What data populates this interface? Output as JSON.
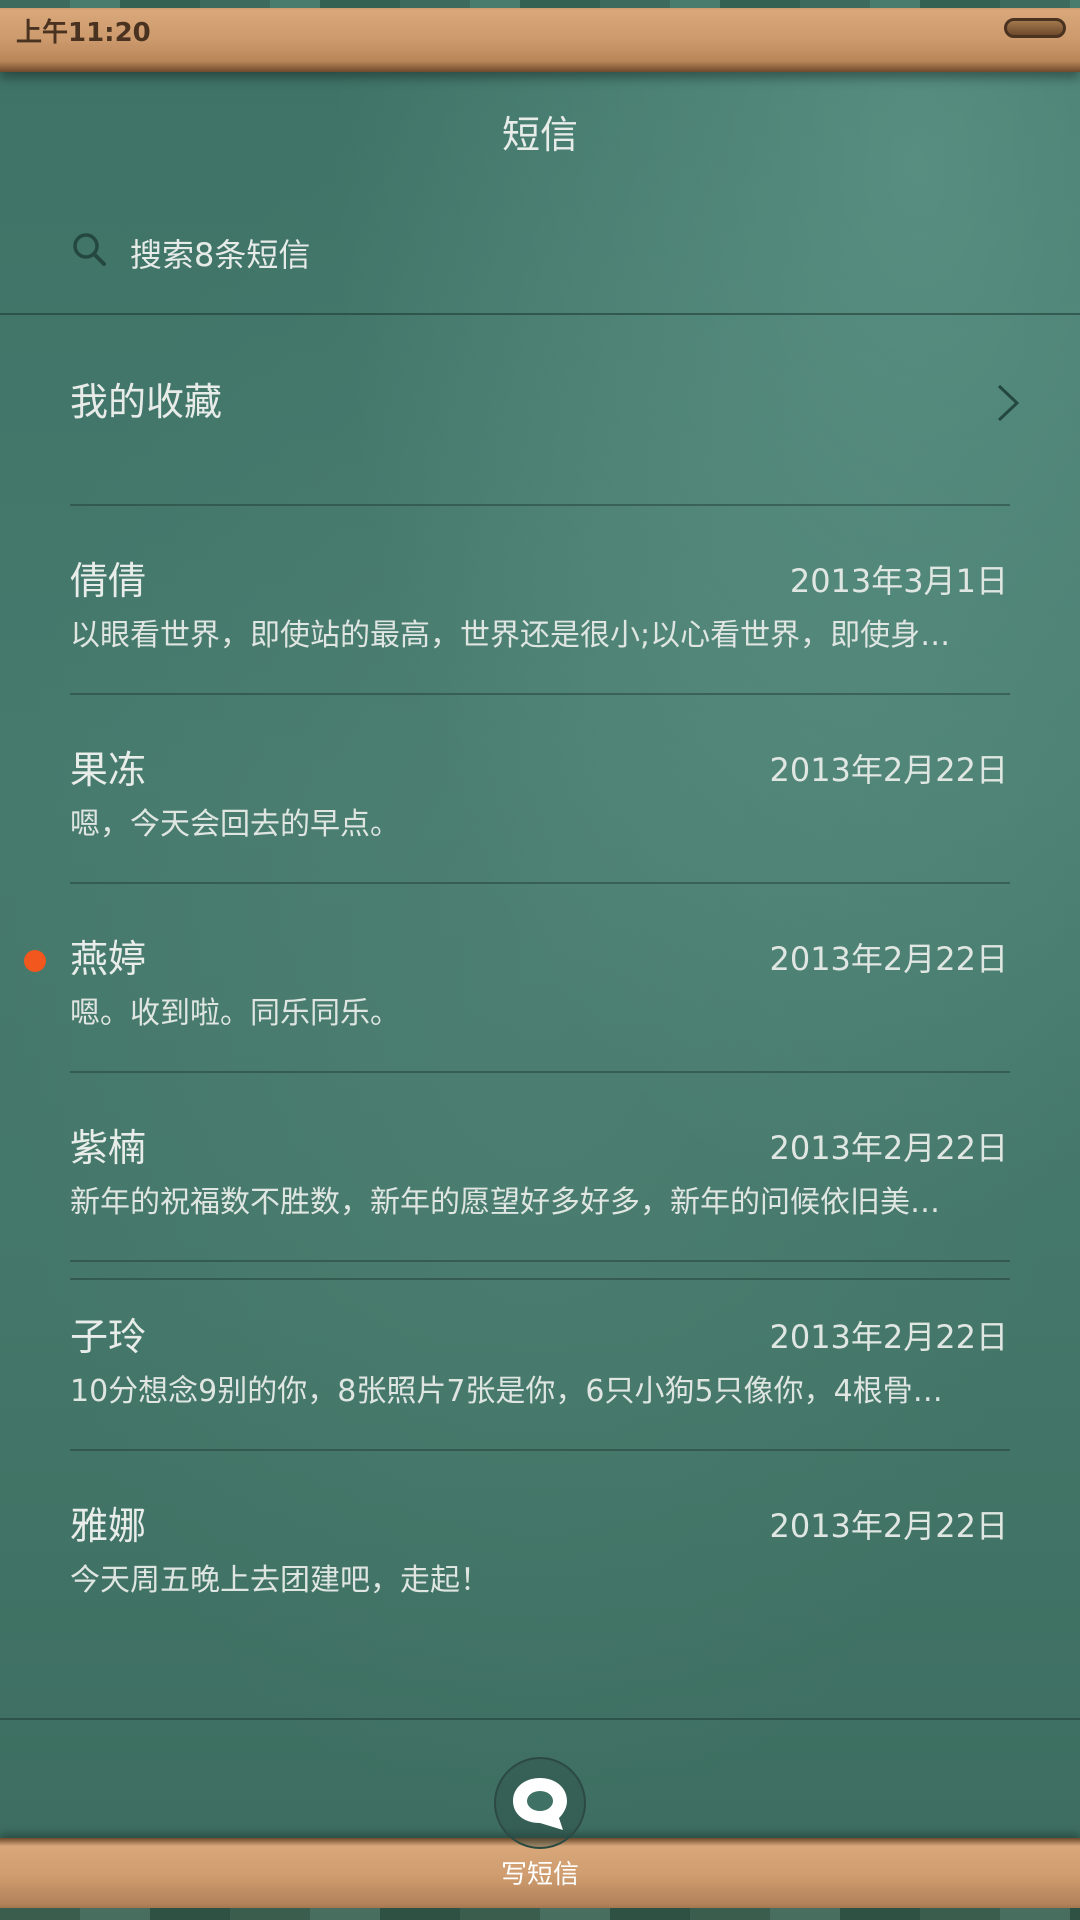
{
  "status_bar": {
    "time": "上午11:20"
  },
  "header": {
    "title": "短信"
  },
  "search": {
    "placeholder": "搜索8条短信"
  },
  "favorites": {
    "label": "我的收藏"
  },
  "conversations": [
    {
      "name": "倩倩",
      "date": "2013年3月1日",
      "preview": "以眼看世界，即使站的最高，世界还是很小;以心看世界，即使身…",
      "unread": false
    },
    {
      "name": "果冻",
      "date": "2013年2月22日",
      "preview": "嗯，今天会回去的早点。",
      "unread": false
    },
    {
      "name": "燕婷",
      "date": "2013年2月22日",
      "preview": "嗯。收到啦。同乐同乐。",
      "unread": true
    },
    {
      "name": "紫楠",
      "date": "2013年2月22日",
      "preview": "新年的祝福数不胜数，新年的愿望好多好多，新年的问候依旧美…",
      "unread": false
    },
    {
      "name": "子玲",
      "date": "2013年2月22日",
      "preview": "10分想念9别的你，8张照片7张是你，6只小狗5只像你，4根骨…",
      "unread": false
    },
    {
      "name": "雅娜",
      "date": "2013年2月22日",
      "preview": "今天周五晚上去团建吧，走起！",
      "unread": false
    }
  ],
  "bottom_bar": {
    "compose_label": "写短信"
  },
  "colors": {
    "unread_dot": "#f2571d",
    "board": "#3f7165",
    "frame_wood": "#cc9a6c"
  }
}
